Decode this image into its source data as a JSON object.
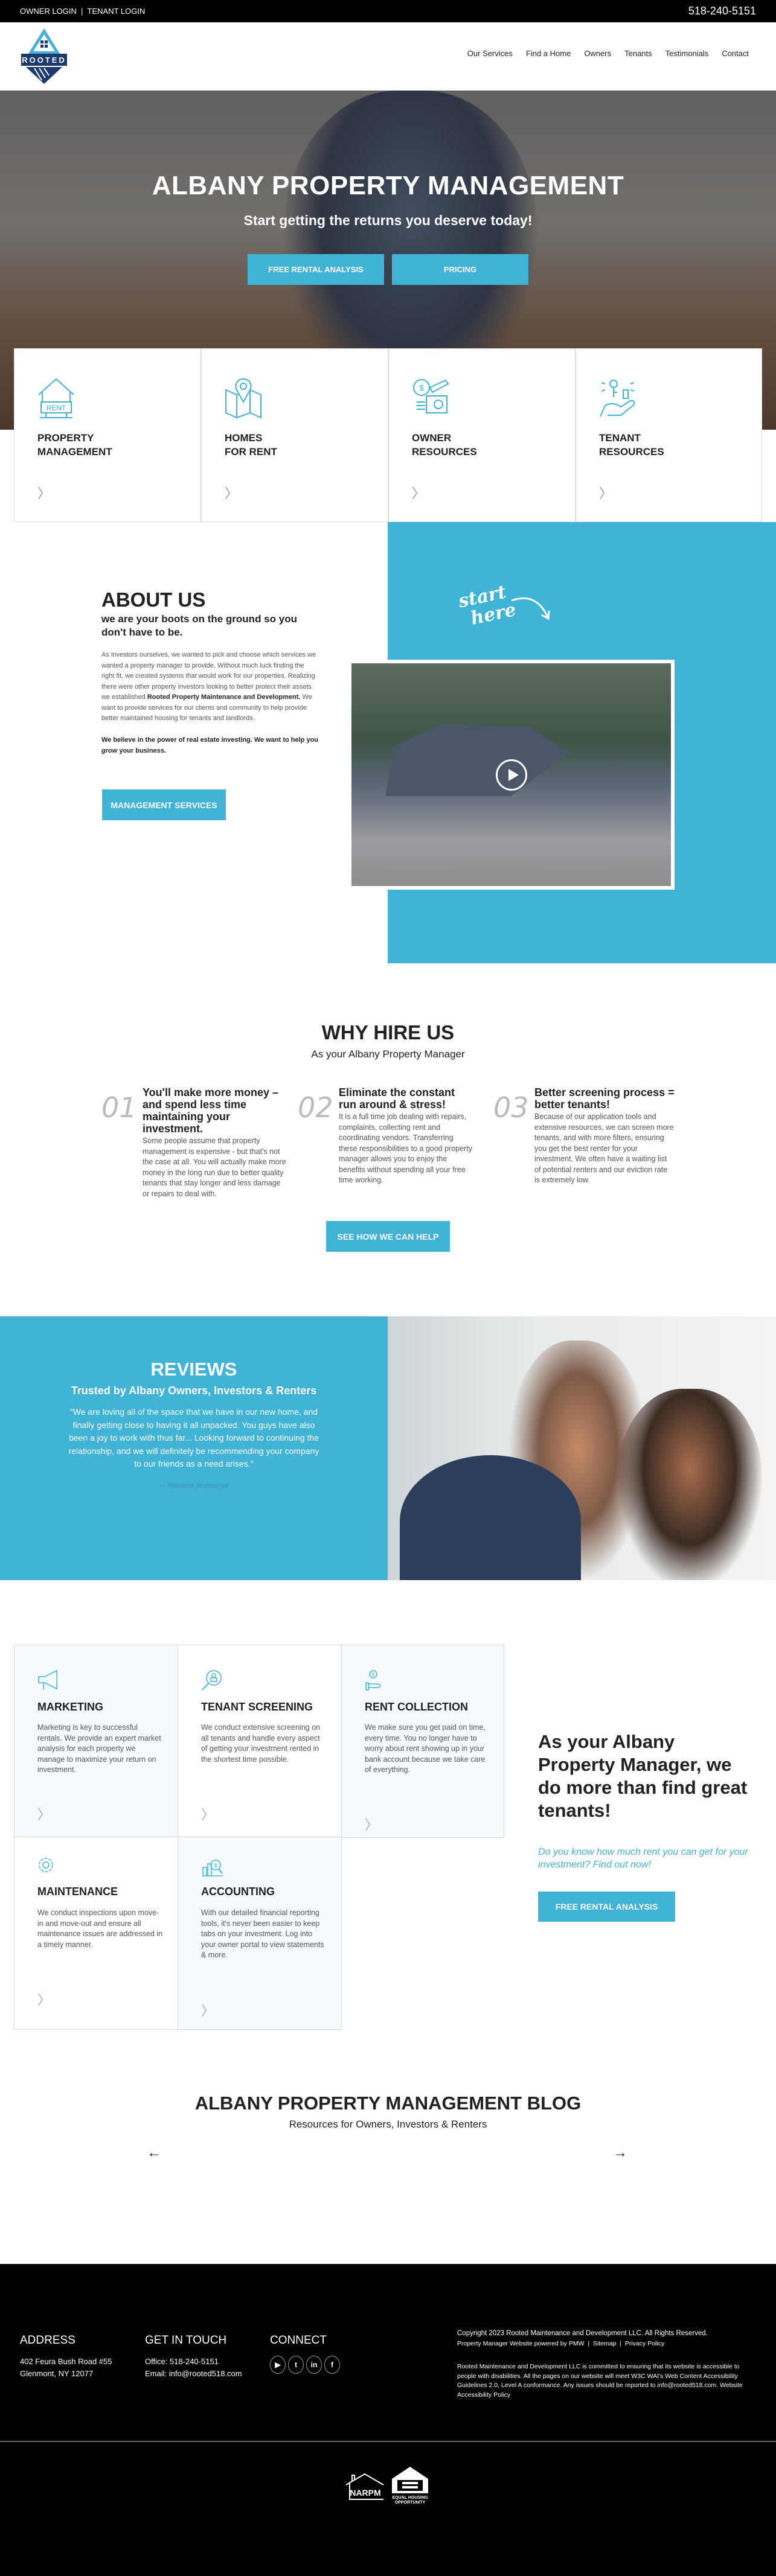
{
  "topbar": {
    "owner_login": "OWNER LOGIN",
    "separator": "|",
    "tenant_login": "TENANT LOGIN",
    "phone": "518-240-5151"
  },
  "logo": {
    "text": "ROOTED"
  },
  "nav": [
    "Our Services",
    "Find a Home",
    "Owners",
    "Tenants",
    "Testimonials",
    "Contact"
  ],
  "hero": {
    "title": "ALBANY PROPERTY MANAGEMENT",
    "subtitle": "Start getting the returns you deserve today!",
    "buttons": [
      "FREE RENTAL ANALYSIS",
      "PRICING"
    ]
  },
  "feature_cards": [
    {
      "line1": "PROPERTY",
      "line2": "MANAGEMENT",
      "icon": "rent-house-icon",
      "icon_text": "RENT"
    },
    {
      "line1": "HOMES",
      "line2": "FOR RENT",
      "icon": "map-pin-icon"
    },
    {
      "line1": "OWNER",
      "line2": "RESOURCES",
      "icon": "finance-report-icon"
    },
    {
      "line1": "TENANT",
      "line2": "RESOURCES",
      "icon": "key-hand-icon"
    }
  ],
  "about": {
    "title": "ABOUT US",
    "subtitle": "we are your boots on the ground so you don't have to be.",
    "para_start": "As investors ourselves, we wanted to pick and choose which services we wanted a property manager to provide. Without much luck finding the right fit, we created systems that would work for our properties. Realizing there were other property investors looking to better protect their assets we established ",
    "para_bold": "Rooted Property Maintenance and Development.",
    "para_end": " We want to provide services for our clients and community to help provide better maintained housing for tenants and landlords.",
    "belief_1": "We believe in the power of real estate investing. We want to help you ",
    "belief_em": "grow",
    "belief_2": " your business.",
    "button": "MANAGEMENT SERVICES",
    "start_here_1": "start",
    "start_here_2": "here"
  },
  "why": {
    "title": "WHY HIRE US",
    "subtitle": "As your Albany Property Manager",
    "items": [
      {
        "num": "01",
        "heading": "You'll make more money – and spend less time maintaining your investment.",
        "body": "Some people assume that property management is expensive - but that's not the case at all. You will actually make more money in the long run due to better quality tenants that stay longer and less damage or repairs to deal with."
      },
      {
        "num": "02",
        "heading": "Eliminate the constant run around & stress!",
        "body": "It is a full time job dealing with repairs, complaints, collecting rent and coordinating vendors. Transferring these responsibilities to a good property manager allows you to enjoy the benefits without spending all your free time working."
      },
      {
        "num": "03",
        "heading": "Better screening process = better tenants!",
        "body": "Because of our application tools and extensive resources, we can screen more tenants, and with more filters, ensuring you get the best renter for your investment. We often have a waiting list of potential renters and our eviction rate is extremely low."
      }
    ],
    "button": "SEE HOW WE CAN HELP"
  },
  "reviews": {
    "title": "REVIEWS",
    "subtitle": "Trusted by Albany Owners, Investors & Renters",
    "quote": "\"We are loving all of the space that we have in our new home, and finally getting close to having it all unpacked. You guys have also been a joy to work with thus far... Looking forward to continuing the relationship, and we will definitely be recommending your company to our friends as a need arises.\"",
    "author": "—  Resident Testimonial"
  },
  "services": [
    {
      "title": "MARKETING",
      "body": "Marketing is key to successful rentals. We provide an expert market analysis for each property we manage to maximize your return on investment.",
      "icon": "megaphone-icon"
    },
    {
      "title": "TENANT SCREENING",
      "body": "We conduct extensive screening on all tenants and handle every aspect of getting your investment rented in the shortest time possible.",
      "icon": "magnifier-person-icon"
    },
    {
      "title": "RENT COLLECTION",
      "body": "We make sure you get paid on time, every time. You no longer have to worry about rent showing up in your bank account because we take care of everything.",
      "icon": "dollar-hand-icon"
    },
    {
      "title": "MAINTENANCE",
      "body": "We conduct inspections upon move-in and move-out and ensure all maintenance issues are addressed in a timely manner.",
      "icon": "gear-icon"
    },
    {
      "title": "ACCOUNTING",
      "body": "With our detailed financial reporting tools, it's never been easier to keep tabs on your investment. Log into your owner portal to view statements & more.",
      "icon": "chart-dollar-icon"
    }
  ],
  "cta": {
    "heading": "As your Albany Property Manager, we do more than find great tenants!",
    "tagline": "Do you know how much rent you can get for your investment? Find out now!",
    "button": "FREE RENTAL ANALYSIS"
  },
  "blog": {
    "title": "ALBANY PROPERTY MANAGEMENT BLOG",
    "subtitle": "Resources for Owners, Investors & Renters",
    "prev": "←",
    "next": "→"
  },
  "footer": {
    "address_title": "ADDRESS",
    "address_1": "402 Feura Bush Road #55",
    "address_2": "Glenmont, NY 12077",
    "contact_title": "GET IN TOUCH",
    "office": "Office: 518-240-5151",
    "email": "Email: info@rooted518.com",
    "connect_title": "CONNECT",
    "social": [
      {
        "icon": "youtube-icon",
        "glyph": "▶"
      },
      {
        "icon": "twitter-icon",
        "glyph": "t"
      },
      {
        "icon": "linkedin-icon",
        "glyph": "in"
      },
      {
        "icon": "facebook-icon",
        "glyph": "f"
      }
    ],
    "copyright": "Copyright 2023 Rooted Maintenance and Development LLC. All Rights Reserved.",
    "powered": "Property Manager Website powered by PMW",
    "sitemap": "Sitemap",
    "privacy": "Privacy Policy",
    "sep": "|",
    "accessibility": "Rooted Maintenance and Development LLC is committed to ensuring that its website is accessible to people with disabilities. All the pages on our website will meet W3C WAI's Web Content Accessibility Guidelines 2.0, Level A conformance. Any issues should be reported to info@rooted518.com.",
    "accessibility_link": "Website Accessibility Policy",
    "narpm": "NARPM",
    "eho_1": "EQUAL HOUSING",
    "eho_2": "OPPORTUNITY"
  },
  "colors": {
    "accent": "#41b3d7",
    "navy": "#1d3a6e",
    "footer_bg": "#000000"
  }
}
